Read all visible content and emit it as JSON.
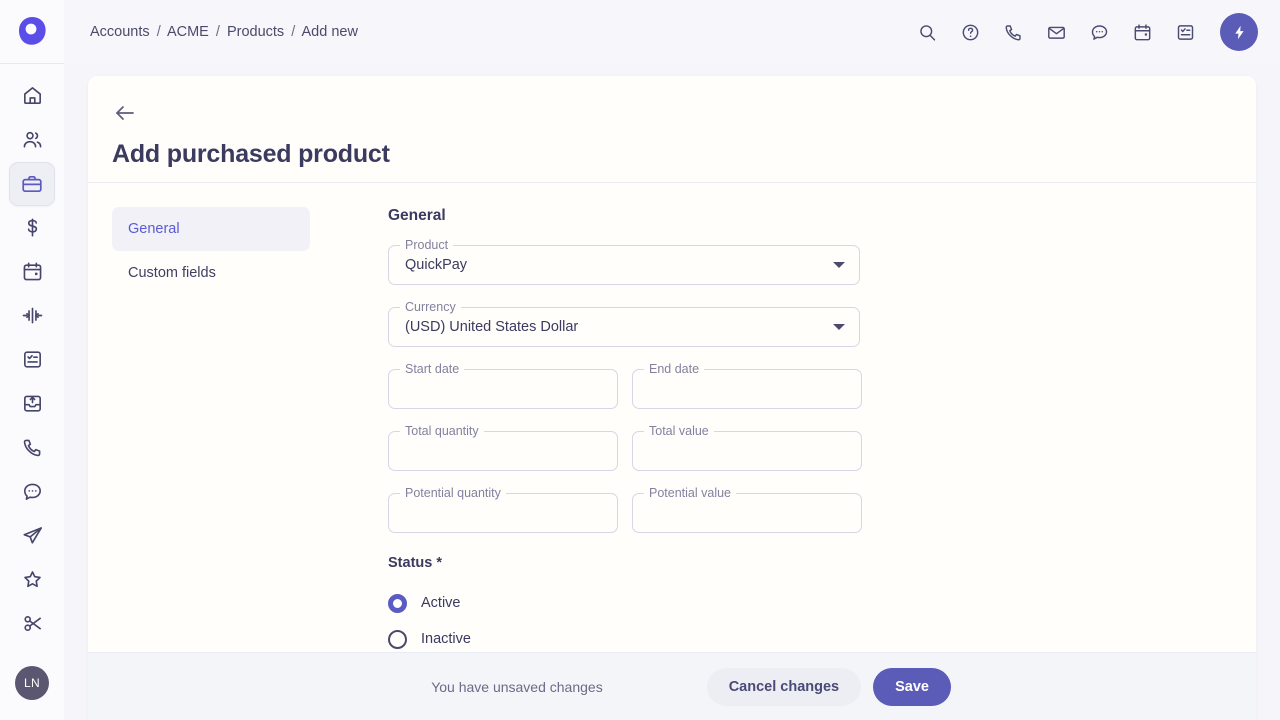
{
  "brand": {
    "accent": "#5b5bbd",
    "primary_button": "#5b5bb8",
    "title_color": "#3b3a5f",
    "logo_icon": "teardrop-logo"
  },
  "rail": {
    "items": [
      {
        "icon": "home-icon",
        "name": "home"
      },
      {
        "icon": "contacts-icon",
        "name": "contacts"
      },
      {
        "icon": "briefcase-icon",
        "name": "deals",
        "active": true
      },
      {
        "icon": "dollar-icon",
        "name": "billing"
      },
      {
        "icon": "calendar-icon",
        "name": "calendar"
      },
      {
        "icon": "activity-icon",
        "name": "activity"
      },
      {
        "icon": "tasks-icon",
        "name": "tasks"
      },
      {
        "icon": "inbox-upload-icon",
        "name": "imports"
      },
      {
        "icon": "phone-icon",
        "name": "calls"
      },
      {
        "icon": "chat-icon",
        "name": "messages"
      },
      {
        "icon": "send-icon",
        "name": "campaigns"
      },
      {
        "icon": "star-icon",
        "name": "favorites"
      },
      {
        "icon": "scissors-icon",
        "name": "snippets"
      }
    ],
    "avatar_initials": "LN"
  },
  "topbar": {
    "breadcrumb": [
      {
        "label": "Accounts"
      },
      {
        "label": "ACME"
      },
      {
        "label": "Products"
      },
      {
        "label": "Add new"
      }
    ],
    "separator": "/",
    "actions": [
      {
        "icon": "search-icon",
        "name": "search"
      },
      {
        "icon": "help-circle-icon",
        "name": "help"
      },
      {
        "icon": "phone-icon",
        "name": "call"
      },
      {
        "icon": "mail-icon",
        "name": "mail"
      },
      {
        "icon": "chat-bubble-icon",
        "name": "chat"
      },
      {
        "icon": "calendar-icon",
        "name": "calendar"
      },
      {
        "icon": "task-list-icon",
        "name": "tasks"
      }
    ],
    "quick_action": {
      "icon": "lightning-bolt-icon",
      "name": "quick-actions"
    }
  },
  "card": {
    "back_icon": "arrow-left-icon",
    "title": "Add purchased product"
  },
  "tabs": [
    {
      "label": "General",
      "active": true
    },
    {
      "label": "Custom fields",
      "active": false
    }
  ],
  "form": {
    "section_title": "General",
    "fields": [
      {
        "label": "Product",
        "value": "QuickPay",
        "type": "select",
        "placeholder": ""
      },
      {
        "label": "Currency",
        "value": "(USD) United States Dollar",
        "type": "select",
        "placeholder": ""
      },
      {
        "label": "Start date",
        "value": "",
        "type": "text",
        "placeholder": ""
      },
      {
        "label": "End date",
        "value": "",
        "type": "text",
        "placeholder": ""
      },
      {
        "label": "Total quantity",
        "value": "",
        "type": "text",
        "placeholder": ""
      },
      {
        "label": "Total value",
        "value": "",
        "type": "text",
        "placeholder": ""
      },
      {
        "label": "Potential quantity",
        "value": "",
        "type": "text",
        "placeholder": ""
      },
      {
        "label": "Potential value",
        "value": "",
        "type": "text",
        "placeholder": ""
      }
    ],
    "status": {
      "label": "Status *",
      "options": [
        {
          "label": "Active",
          "selected": true
        },
        {
          "label": "Inactive",
          "selected": false
        }
      ]
    }
  },
  "footer": {
    "unsaved_text": "You have unsaved changes",
    "cancel_label": "Cancel changes",
    "save_label": "Save"
  }
}
